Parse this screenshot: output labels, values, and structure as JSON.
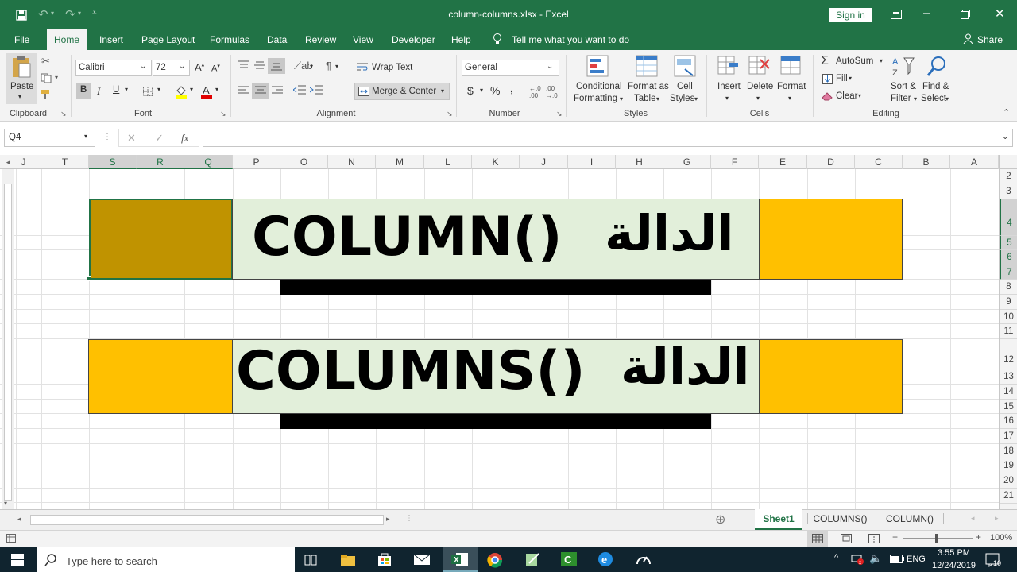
{
  "window": {
    "title": "column-columns.xlsx  -  Excel",
    "signin": "Sign in"
  },
  "tabs": [
    "File",
    "Home",
    "Insert",
    "Page Layout",
    "Formulas",
    "Data",
    "Review",
    "View",
    "Developer",
    "Help"
  ],
  "tellme": "Tell me what you want to do",
  "share": "Share",
  "clipboard": {
    "paste": "Paste",
    "label": "Clipboard"
  },
  "font": {
    "name": "Calibri",
    "size": "72",
    "bold": "B",
    "italic": "I",
    "underline": "U",
    "label": "Font"
  },
  "alignment": {
    "wrap": "Wrap Text",
    "merge": "Merge & Center",
    "label": "Alignment"
  },
  "number": {
    "format": "General",
    "currency": "$",
    "percent": "%",
    "comma": ",",
    "label": "Number"
  },
  "styles": {
    "conditional": "Conditional",
    "conditional2": "Formatting",
    "formatas": "Format as",
    "formatas2": "Table",
    "cell": "Cell",
    "cell2": "Styles",
    "label": "Styles"
  },
  "cells": {
    "insert": "Insert",
    "delete": "Delete",
    "format": "Format",
    "label": "Cells"
  },
  "editing": {
    "autosum": "AutoSum",
    "fill": "Fill",
    "clear": "Clear",
    "sort": "Sort &",
    "sort2": "Filter",
    "find": "Find &",
    "find2": "Select",
    "label": "Editing"
  },
  "namebox": "Q4",
  "fx": "fx",
  "columns": [
    "J",
    "T",
    "S",
    "R",
    "Q",
    "P",
    "O",
    "N",
    "M",
    "L",
    "K",
    "J",
    "I",
    "H",
    "G",
    "F",
    "E",
    "D",
    "C",
    "B",
    "A"
  ],
  "rows": [
    "2",
    "3",
    "4",
    "5",
    "6",
    "7",
    "8",
    "9",
    "10",
    "11",
    "12",
    "13",
    "14",
    "15",
    "16",
    "17",
    "18",
    "19",
    "20",
    "21"
  ],
  "banner1": {
    "en": "COLUMN()",
    "ar": "الدالة"
  },
  "banner2": {
    "en": "COLUMNS()",
    "ar": "الدالة"
  },
  "sheets": [
    "Sheet1",
    "COLUMNS()",
    "COLUMN()"
  ],
  "zoom": "100%",
  "taskbar": {
    "search": "Type here to search",
    "lang": "ENG",
    "time": "3:55 PM",
    "date": "12/24/2019",
    "notif": "10"
  },
  "colors": {
    "green": "#217346",
    "gold": "#ffc000",
    "darkgold": "#c09300",
    "banner": "#e2efda"
  }
}
